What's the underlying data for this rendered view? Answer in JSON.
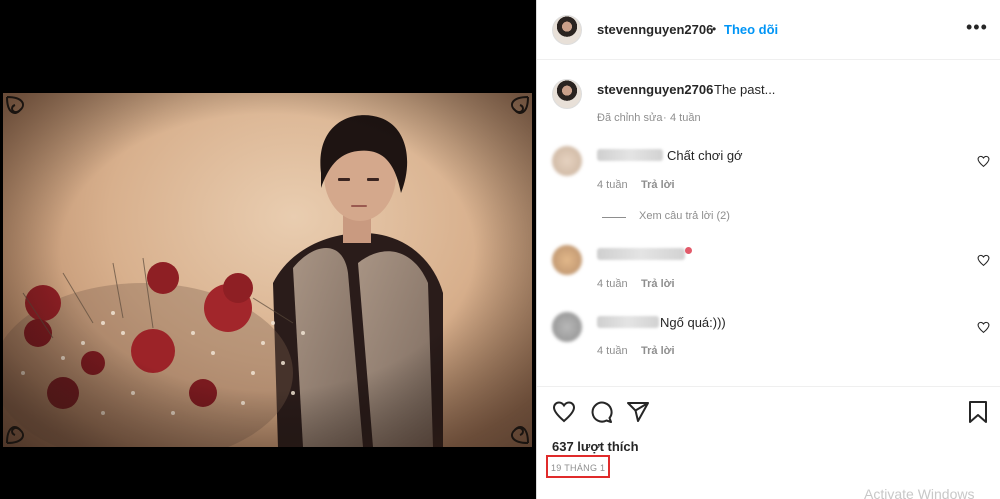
{
  "post": {
    "username": "stevennguyen2706",
    "separator": "•",
    "follow_label": "Theo dõi",
    "more_icon": "more-options-icon"
  },
  "caption": {
    "username": "stevennguyen2706",
    "text": "The past...",
    "edited_label": "Đã chỉnh sửa",
    "time": "4 tuần"
  },
  "comments": [
    {
      "text": "Chất chơi gớ",
      "time": "4 tuần",
      "reply_label": "Trả lời",
      "view_replies": "Xem câu trả lời (2)"
    },
    {
      "text": "",
      "time": "4 tuần",
      "reply_label": "Trả lời"
    },
    {
      "text": "Ngố quá:)))",
      "time": "4 tuần",
      "reply_label": "Trả lời"
    }
  ],
  "actions": {
    "likes": "637 lượt thích",
    "date": "19 THÁNG 1",
    "icons": [
      "like-icon",
      "comment-icon",
      "share-icon",
      "save-icon"
    ]
  },
  "watermark": "Activate Windows",
  "colors": {
    "follow": "#0095f6",
    "highlight": "#e02b2b",
    "muted": "#8e8e8e"
  }
}
